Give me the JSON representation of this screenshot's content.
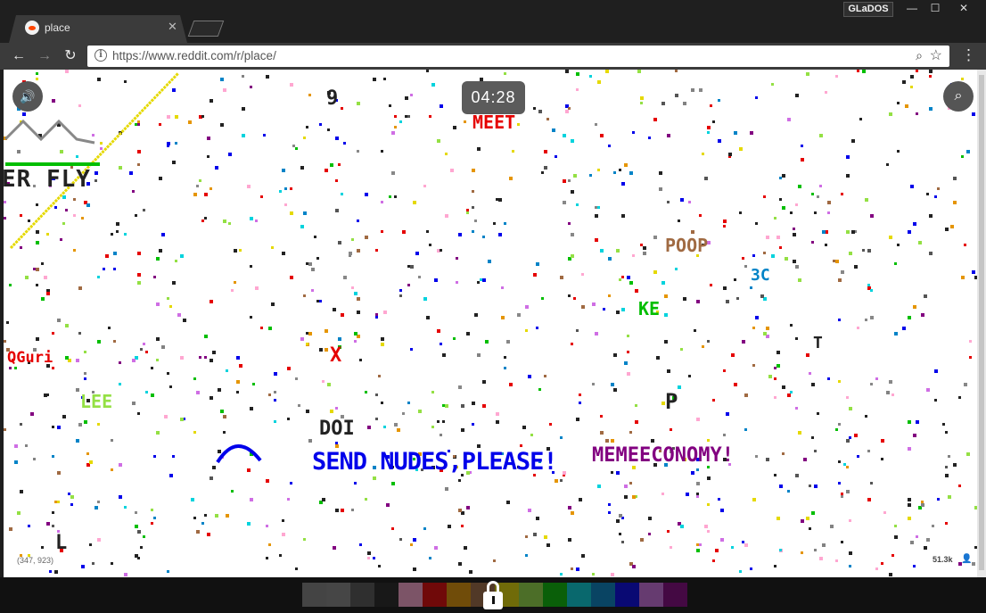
{
  "browser": {
    "tab_title": "place",
    "profile_name": "GLaDOS",
    "url": "https://www.reddit.com/r/place/",
    "window_controls": {
      "minimize": "—",
      "maximize": "☐",
      "close": "✕"
    },
    "icons": {
      "back": "back-arrow-icon",
      "forward": "forward-arrow-icon",
      "reload": "reload-icon",
      "info": "info-icon",
      "zoom": "zoom-icon",
      "bookmark": "star-icon",
      "menu": "kebab-menu-icon"
    }
  },
  "place": {
    "timer": "04:28",
    "coordinates": "(347, 923)",
    "active_users": "51.3k",
    "canvas_texts": [
      {
        "text": "ER FLY",
        "color": "#222222"
      },
      {
        "text": "MEMEECONOMY!",
        "color": "#820080"
      },
      {
        "text": "SEND NUDES,PLEASE!",
        "color": "#0000ea"
      },
      {
        "text": "MEET",
        "color": "#e50000"
      },
      {
        "text": "POOP",
        "color": "#a06a42"
      },
      {
        "text": "LEE",
        "color": "#94e044"
      },
      {
        "text": "QGuri",
        "color": "#e50000"
      },
      {
        "text": "KE",
        "color": "#02be01"
      },
      {
        "text": "DOI",
        "color": "#222222"
      },
      {
        "text": "3C",
        "color": "#0083c7"
      },
      {
        "text": "P",
        "color": "#222222"
      },
      {
        "text": "X",
        "color": "#e50000"
      },
      {
        "text": "T",
        "color": "#222222"
      },
      {
        "text": "L",
        "color": "#222222"
      },
      {
        "text": "9",
        "color": "#222222"
      }
    ],
    "palette": [
      "#828282",
      "#888888",
      "#555555",
      "#222222",
      "#ffa7d1",
      "#e50000",
      "#e59500",
      "#a06a42",
      "#e5d900",
      "#94e044",
      "#02be01",
      "#00d3dd",
      "#0083c7",
      "#0000ea",
      "#cf6ee4",
      "#820080"
    ]
  }
}
